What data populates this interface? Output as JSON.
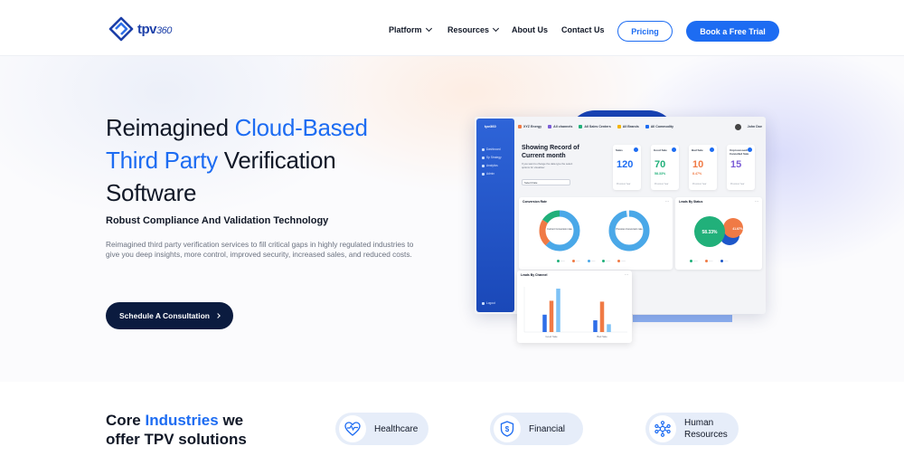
{
  "header": {
    "logo_text": "tpv",
    "logo_suffix": "360",
    "nav": [
      {
        "label": "Platform",
        "has_dropdown": true
      },
      {
        "label": "Resources",
        "has_dropdown": true
      },
      {
        "label": "About Us",
        "has_dropdown": false
      },
      {
        "label": "Contact Us",
        "has_dropdown": false
      }
    ],
    "pricing_label": "Pricing",
    "trial_label": "Book a Free Trial"
  },
  "hero": {
    "title_1": "Reimagined ",
    "title_highlight_1": "Cloud-Based",
    "title_highlight_2": "Third Party",
    "title_2": " Verification",
    "title_3": "Software",
    "subtitle": "Robust Compliance And Validation Technology",
    "description": "Reimagined third party verification services to fill critical gaps in highly regulated industries to give you deep insights, more control, improved security, increased sales, and reduced costs.",
    "cta_label": "Schedule A Consultation"
  },
  "dashboard": {
    "sidebar": {
      "logo": "tpv360",
      "items": [
        "Dashboard",
        "Sp Strategy",
        "Analytics",
        "Admin"
      ],
      "logout": "Logout"
    },
    "topbar": {
      "brand": "XYZ Energy",
      "filters": [
        "All channels",
        "All Sales Centers",
        "All Brands",
        "All Commodity"
      ],
      "user": "John Doe"
    },
    "record_title": "Showing Record of Current month",
    "record_sub": "If you want to change the data type the select options for visualiser",
    "select_label": "Select Date",
    "kpis": [
      {
        "label": "Sales",
        "value": "120",
        "pct": "",
        "foot": "Previous Year",
        "color": "#1d6cf2"
      },
      {
        "label": "Good Sale",
        "value": "70",
        "pct": "58.33%",
        "foot": "Previous Year",
        "color": "#21b07a"
      },
      {
        "label": "Bad Sale",
        "value": "10",
        "pct": "8.47%",
        "foot": "Previous Year",
        "color": "#f07a45"
      },
      {
        "label": "Unprocessed/ Cancelled Sale",
        "value": "15",
        "pct": "",
        "foot": "Previous Year",
        "color": "#7b5cd6"
      }
    ],
    "conversion_rate": {
      "title": "Conversion Rate",
      "donut_1_label": "Current Conversion rate",
      "donut_2_label": "Previous Conversion rate",
      "donut_1_segments": [
        0.62,
        0.22,
        0.16
      ],
      "donut_2_segments": [
        1.0
      ],
      "colors": [
        "#4aa8e8",
        "#f07a45",
        "#21b07a"
      ]
    },
    "leads_by_status": {
      "title": "Leads By Status",
      "big_pct": "58.33%",
      "side_pct": "41.67%",
      "colors": [
        "#21b07a",
        "#f07a45",
        "#1d57c9"
      ]
    },
    "leads_by_channel": {
      "title": "Leads By Channel",
      "categories": [
        "Good Sale",
        "Bad Sale"
      ],
      "series": [
        {
          "values": [
            0.4,
            0.27
          ],
          "color": "#2f6ee8"
        },
        {
          "values": [
            0.72,
            0.7
          ],
          "color": "#f07a45"
        },
        {
          "values": [
            1.0,
            0.18
          ],
          "color": "#7ec2f5"
        }
      ]
    }
  },
  "core": {
    "title_1": "Core ",
    "title_highlight": "Industries",
    "title_2": " we",
    "title_3": "offer TPV solutions",
    "industries": [
      {
        "label": "Healthcare",
        "icon": "heart-pulse-icon"
      },
      {
        "label": "Financial",
        "icon": "shield-dollar-icon"
      },
      {
        "label": "Human Resources",
        "icon": "people-network-icon"
      }
    ]
  }
}
